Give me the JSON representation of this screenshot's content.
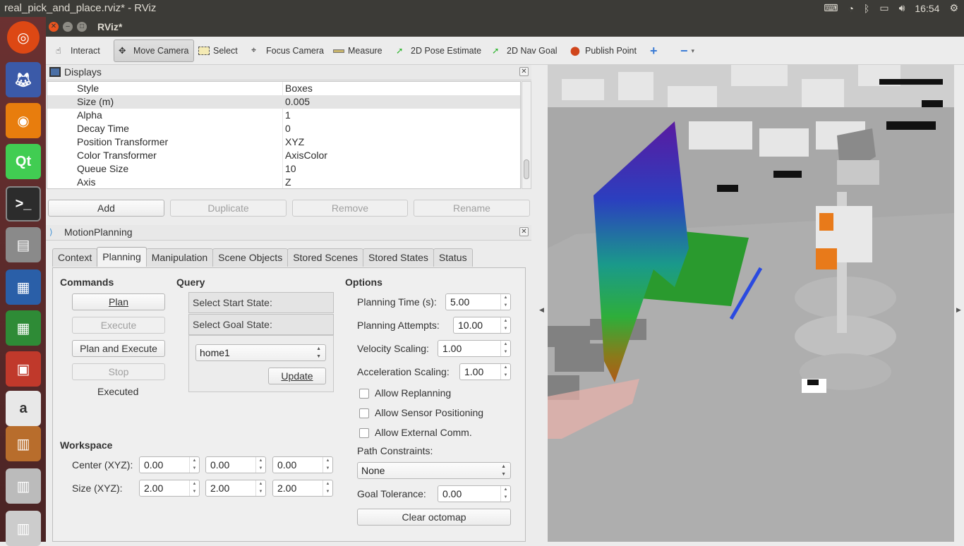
{
  "os_bar": {
    "window_title": "real_pick_and_place.rviz* - RViz",
    "clock": "16:54"
  },
  "window": {
    "title": "RViz*"
  },
  "toolbar": {
    "interact": "Interact",
    "move_camera": "Move Camera",
    "select": "Select",
    "focus_camera": "Focus Camera",
    "measure": "Measure",
    "pose_estimate": "2D Pose Estimate",
    "nav_goal": "2D Nav Goal",
    "publish_point": "Publish Point"
  },
  "displays": {
    "title": "Displays",
    "properties": [
      {
        "key": "Style",
        "value": "Boxes"
      },
      {
        "key": "Size (m)",
        "value": "0.005"
      },
      {
        "key": "Alpha",
        "value": "1"
      },
      {
        "key": "Decay Time",
        "value": "0"
      },
      {
        "key": "Position Transformer",
        "value": "XYZ"
      },
      {
        "key": "Color Transformer",
        "value": "AxisColor"
      },
      {
        "key": "Queue Size",
        "value": "10"
      },
      {
        "key": "Axis",
        "value": "Z"
      }
    ],
    "buttons": {
      "add": "Add",
      "duplicate": "Duplicate",
      "remove": "Remove",
      "rename": "Rename"
    }
  },
  "motion_planning": {
    "title": "MotionPlanning",
    "tabs": [
      "Context",
      "Planning",
      "Manipulation",
      "Scene Objects",
      "Stored Scenes",
      "Stored States",
      "Status"
    ],
    "active_tab": "Planning",
    "commands": {
      "heading": "Commands",
      "plan": "Plan",
      "execute": "Execute",
      "plan_and_execute": "Plan and Execute",
      "stop": "Stop",
      "status": "Executed"
    },
    "query": {
      "heading": "Query",
      "start_state": "Select Start State:",
      "goal_state": "Select Goal State:",
      "goal_value": "home1",
      "update": "Update"
    },
    "options": {
      "heading": "Options",
      "planning_time_label": "Planning Time (s):",
      "planning_time": "5.00",
      "planning_attempts_label": "Planning Attempts:",
      "planning_attempts": "10.00",
      "velocity_scaling_label": "Velocity Scaling:",
      "velocity_scaling": "1.00",
      "acceleration_scaling_label": "Acceleration Scaling:",
      "acceleration_scaling": "1.00",
      "allow_replanning": "Allow Replanning",
      "allow_sensor_positioning": "Allow Sensor Positioning",
      "allow_external_comm": "Allow External Comm.",
      "path_constraints_label": "Path Constraints:",
      "path_constraints": "None",
      "goal_tolerance_label": "Goal Tolerance:",
      "goal_tolerance": "0.00",
      "clear_octomap": "Clear octomap"
    },
    "workspace": {
      "heading": "Workspace",
      "center_label": "Center (XYZ):",
      "size_label": "Size (XYZ):",
      "center": [
        "0.00",
        "0.00",
        "0.00"
      ],
      "size": [
        "2.00",
        "2.00",
        "2.00"
      ]
    }
  }
}
